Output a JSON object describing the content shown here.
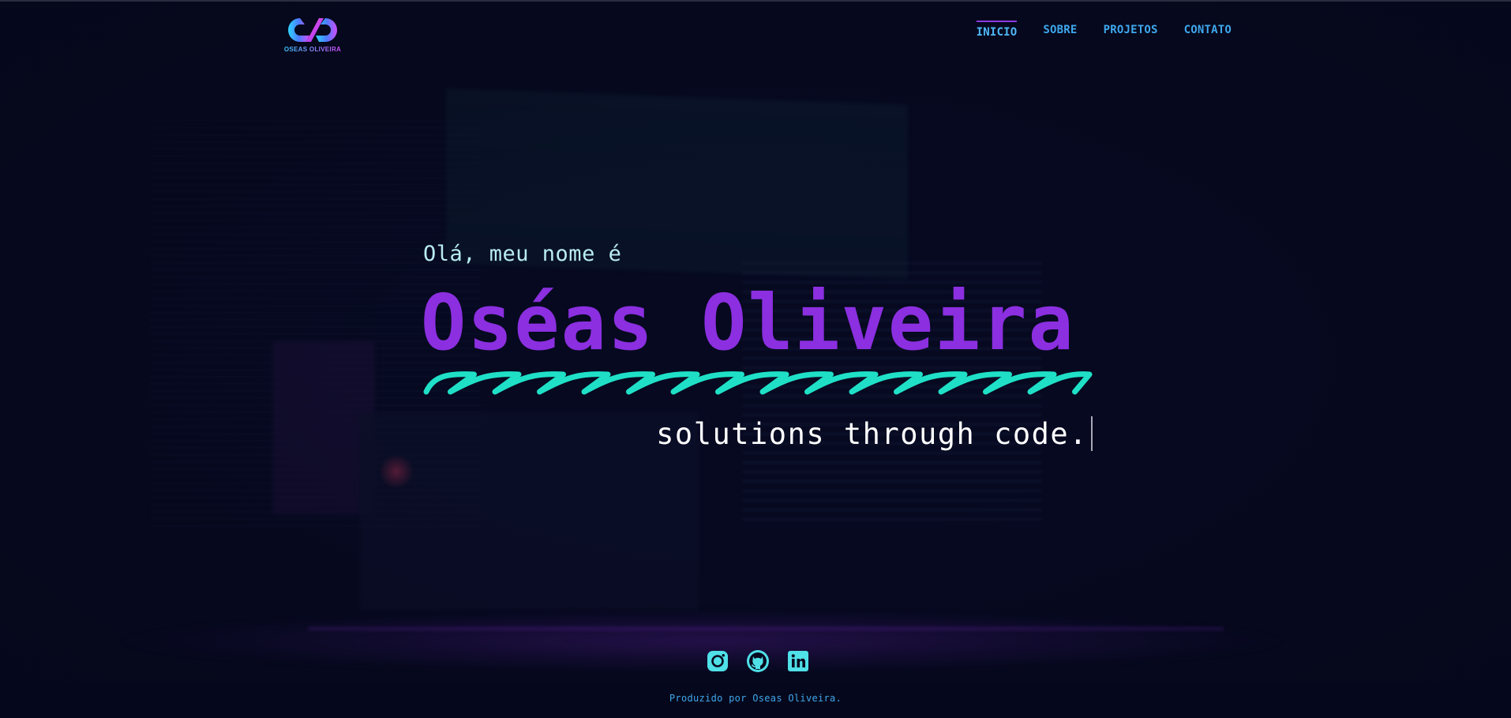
{
  "brand": {
    "logo_text": "OSEAS OLIVEIRA"
  },
  "nav": {
    "items": [
      {
        "label": "INICIO",
        "active": true
      },
      {
        "label": "SOBRE",
        "active": false
      },
      {
        "label": "PROJETOS",
        "active": false
      },
      {
        "label": "CONTATO",
        "active": false
      }
    ]
  },
  "hero": {
    "greeting": "Olá, meu nome é",
    "name": "Oséas Oliveira",
    "tagline": "solutions through code."
  },
  "socials": [
    {
      "icon": "instagram-icon"
    },
    {
      "icon": "github-icon"
    },
    {
      "icon": "linkedin-icon"
    }
  ],
  "footer": {
    "credit": "Produzido por Oseas Oliveira."
  },
  "colors": {
    "background": "#060920",
    "accent_purple": "#8b2fe0",
    "accent_teal": "#1fe0c7",
    "nav_blue": "#3ea7ec",
    "icon_cyan": "#4fe0e8"
  }
}
